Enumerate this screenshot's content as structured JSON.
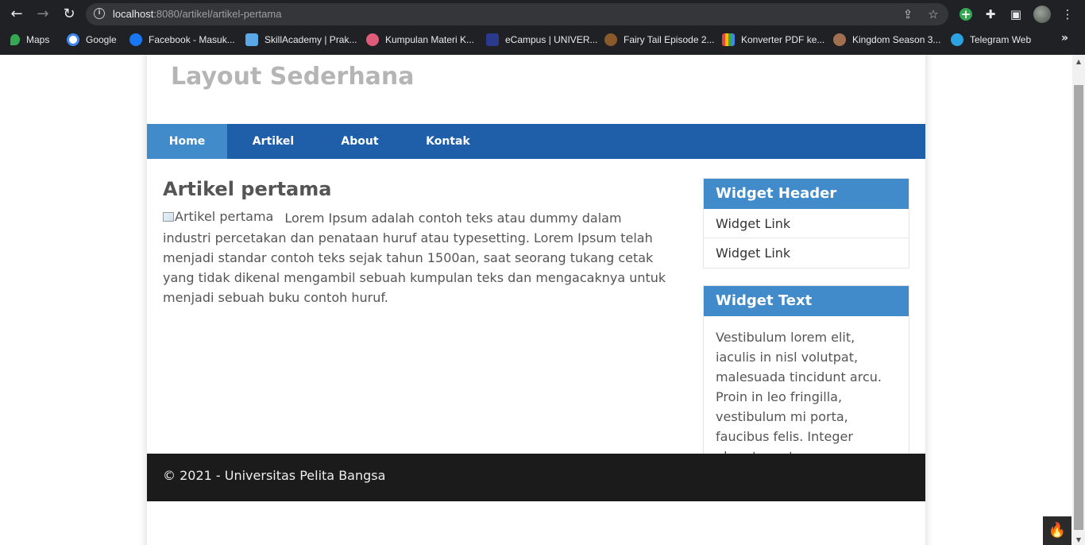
{
  "browser": {
    "url_host": "localhost",
    "url_path": ":8080/artikel/artikel-pertama",
    "bookmarks": [
      {
        "label": "Maps",
        "color": "#34a853"
      },
      {
        "label": "Google",
        "color": "#4285f4"
      },
      {
        "label": "Facebook - Masuk...",
        "color": "#1877f2"
      },
      {
        "label": "SkillAcademy | Prak...",
        "color": "#5aa9e6"
      },
      {
        "label": "Kumpulan Materi K...",
        "color": "#e05a7a"
      },
      {
        "label": "eCampus | UNIVER...",
        "color": "#2b3a8c"
      },
      {
        "label": "Fairy Tail Episode 2...",
        "color": "#8a5a2b"
      },
      {
        "label": "Konverter PDF ke...",
        "color": "#f4b400"
      },
      {
        "label": "Kingdom Season 3...",
        "color": "#a07050"
      },
      {
        "label": "Telegram Web",
        "color": "#2aa3e0"
      }
    ],
    "more_label": "»"
  },
  "site": {
    "title": "Layout Sederhana",
    "nav": [
      "Home",
      "Artikel",
      "About",
      "Kontak"
    ],
    "active_nav": "Home",
    "accent": "#428bca",
    "nav_bg": "#1f5faa"
  },
  "article": {
    "title": "Artikel pertama",
    "image_alt": "Artikel pertama",
    "body": "Lorem Ipsum adalah contoh teks atau dummy dalam industri percetakan dan penataan huruf atau typesetting. Lorem Ipsum telah menjadi standar contoh teks sejak tahun 1500an, saat seorang tukang cetak yang tidak dikenal mengambil sebuah kumpulan teks dan mengacaknya untuk menjadi sebuah buku contoh huruf."
  },
  "sidebar": {
    "widget1": {
      "header": "Widget Header",
      "links": [
        "Widget Link",
        "Widget Link"
      ]
    },
    "widget2": {
      "header": "Widget Text",
      "text": "Vestibulum lorem elit, iaculis in nisl volutpat, malesuada tincidunt arcu. Proin in leo fringilla, vestibulum mi porta, faucibus felis. Integer pharetra est nunc, nec pretium nunc pretium ac."
    }
  },
  "footer": {
    "text": "© 2021 - Universitas Pelita Bangsa"
  }
}
